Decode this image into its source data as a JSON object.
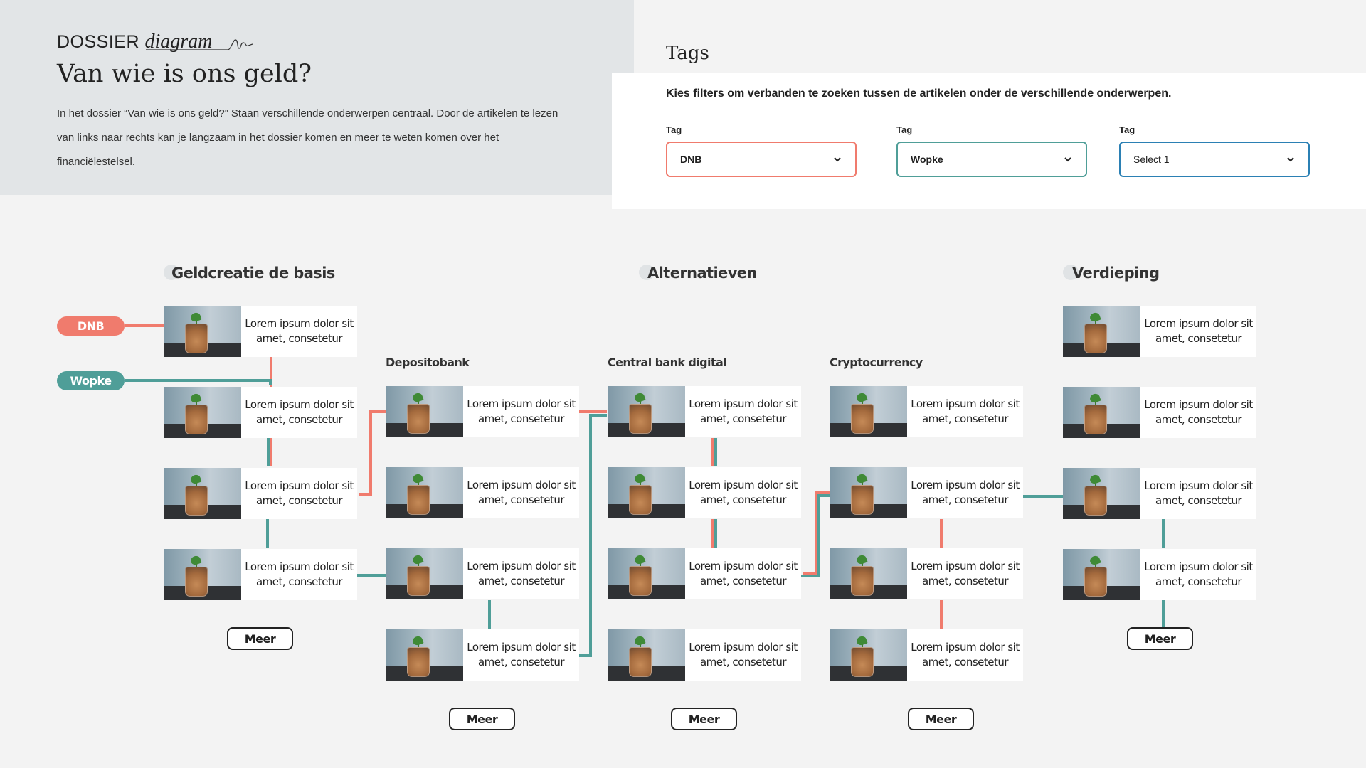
{
  "header": {
    "brand_main": "DOSSIER",
    "brand_italic": "diagram",
    "title": "Van wie is ons geld?",
    "intro": "In het dossier “Van wie is ons geld?” Staan verschillende onderwerpen centraal. Door de artikelen te lezen van links naar rechts kan je langzaam in het dossier komen en meer te weten komen over het financiëlestelsel."
  },
  "tags": {
    "title": "Tags",
    "description": "Kies filters om verbanden te zoeken tussen de artikelen onder de verschillende onderwerpen.",
    "filters": [
      {
        "label": "Tag",
        "value": "DNB",
        "color": "#f07b6d"
      },
      {
        "label": "Tag",
        "value": "Wopke",
        "color": "#4f9e98"
      },
      {
        "label": "Tag",
        "value": "Select 1",
        "color": "#2b80b4"
      }
    ]
  },
  "colors": {
    "dnb": "#f07b6d",
    "wopke": "#4f9e98",
    "select": "#2b80b4"
  },
  "pills": {
    "dnb": "DNB",
    "wopke": "Wopke"
  },
  "columns": [
    {
      "title": "Geldcreatie de basis"
    },
    {
      "title": "Alternatieven"
    },
    {
      "title": "Verdieping"
    }
  ],
  "subcolumns": [
    {
      "title": "Depositobank"
    },
    {
      "title": "Central bank digital"
    },
    {
      "title": "Cryptocurrency"
    }
  ],
  "card_text": "Lorem ipsum dolor sit amet, consetetur",
  "meer_label": "Meer",
  "image_icon": "plant-in-coin-jar-image"
}
